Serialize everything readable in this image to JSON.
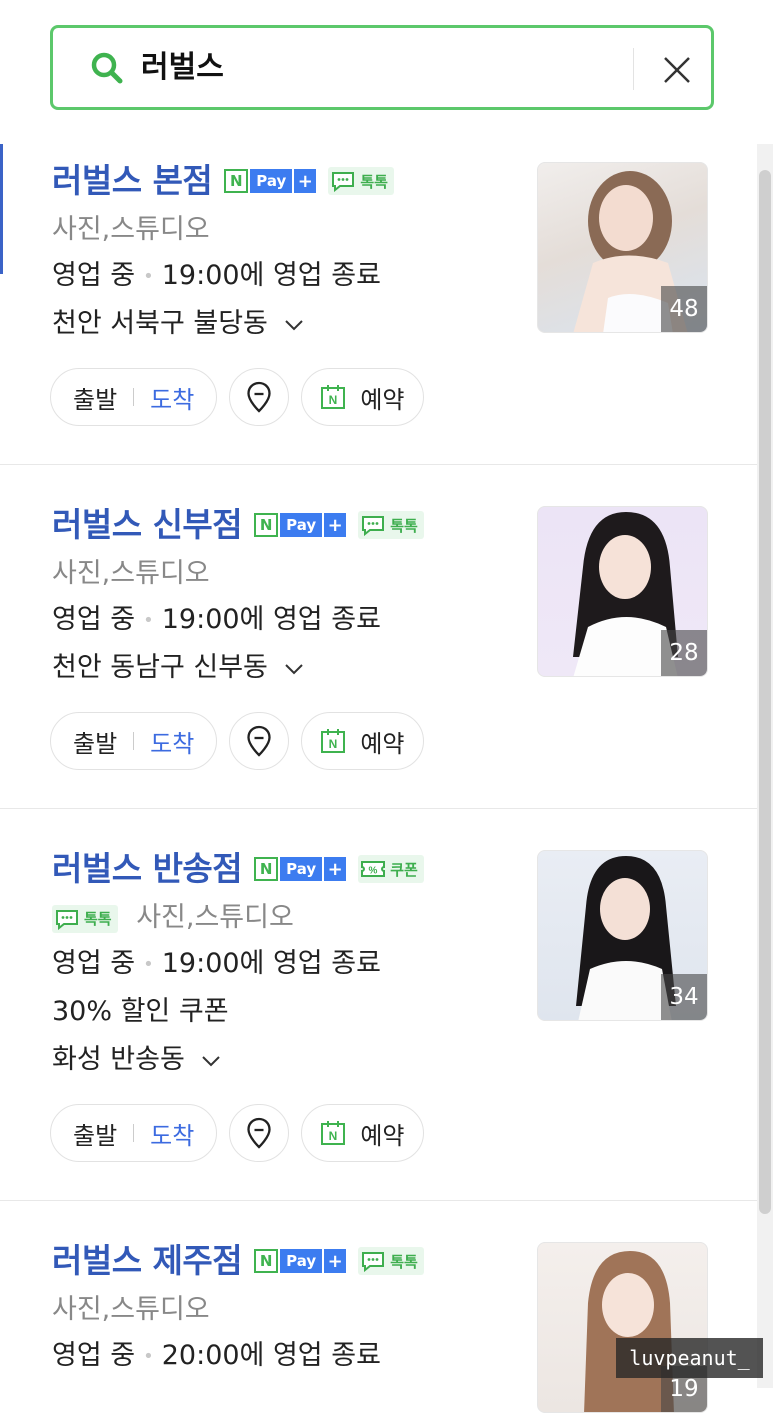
{
  "search": {
    "query": "러벌스",
    "colors": {
      "border": "#5cc86b",
      "icon": "#3fb34f"
    }
  },
  "badges": {
    "npay_n": "N",
    "npay_pay": "Pay",
    "npay_plus": "+",
    "talk": "톡톡",
    "coupon": "쿠폰"
  },
  "common": {
    "route_departure": "출발",
    "route_arrival": "도착",
    "reserve": "예약",
    "status_open": "영업 중",
    "category": "사진,스튜디오"
  },
  "results": [
    {
      "name": "러벌스 본점",
      "close_time": "19:00에 영업 종료",
      "address": "천안 서북구 불당동",
      "photo_count": "48"
    },
    {
      "name": "러벌스 신부점",
      "close_time": "19:00에 영업 종료",
      "address": "천안 동남구 신부동",
      "photo_count": "28"
    },
    {
      "name": "러벌스 반송점",
      "close_time": "19:00에 영업 종료",
      "coupon_text": "30% 할인 쿠폰",
      "address": "화성 반송동",
      "photo_count": "34"
    },
    {
      "name": "러벌스 제주점",
      "close_time": "20:00에 영업 종료",
      "photo_count": "19"
    }
  ],
  "watermark": "luvpeanut_",
  "colors": {
    "title": "#3259b8",
    "arrival": "#3c6be0",
    "npay_blue": "#3c7cf0",
    "naver_green": "#3fb34f"
  }
}
